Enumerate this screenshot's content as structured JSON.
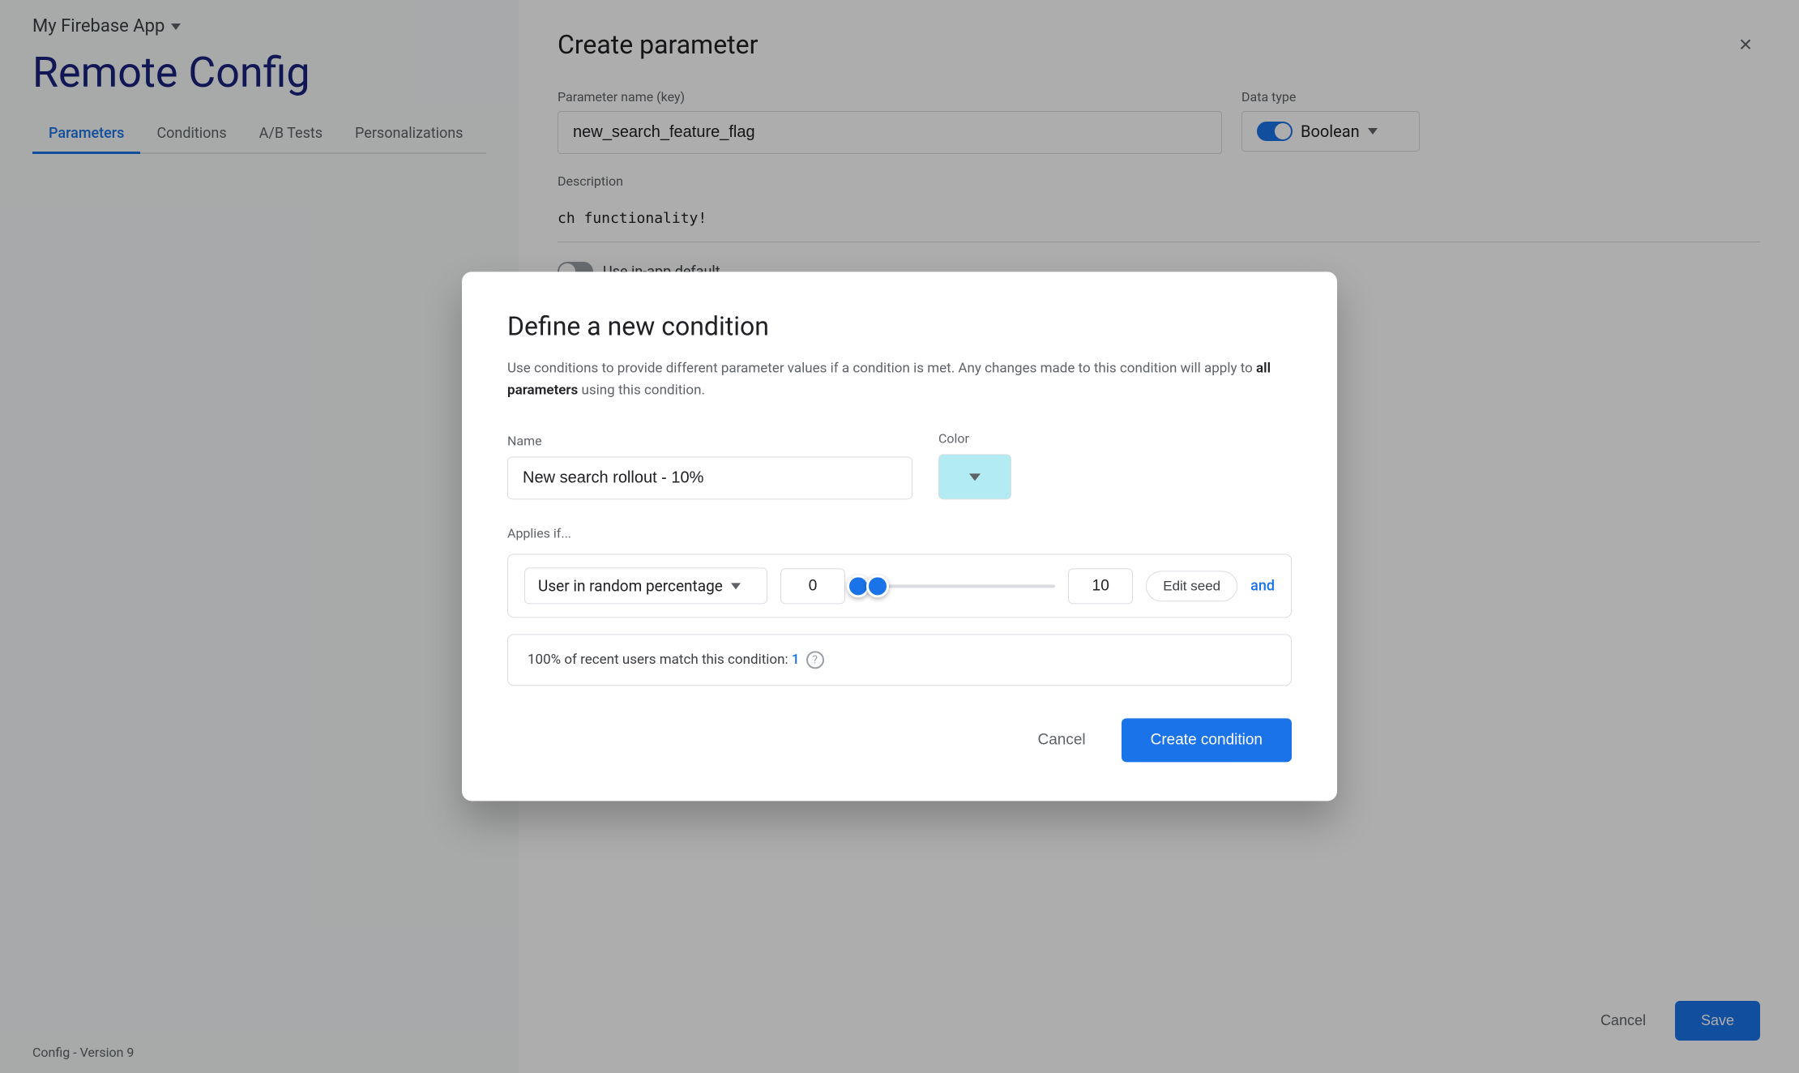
{
  "app": {
    "name": "My Firebase App",
    "dropdown_label": "dropdown"
  },
  "page": {
    "title": "Remote Config",
    "status_bar": "Config - Version 9"
  },
  "tabs": [
    {
      "id": "parameters",
      "label": "Parameters",
      "active": true
    },
    {
      "id": "conditions",
      "label": "Conditions",
      "active": false
    },
    {
      "id": "ab_tests",
      "label": "A/B Tests",
      "active": false
    },
    {
      "id": "personalizations",
      "label": "Personalizations",
      "active": false
    }
  ],
  "create_param_panel": {
    "title": "Create parameter",
    "close_label": "×",
    "fields": {
      "param_name_label": "Parameter name (key)",
      "param_name_value": "new_search_feature_flag",
      "data_type_label": "Data type",
      "data_type_value": "Boolean",
      "description_label": "Description",
      "description_value": "ch functionality!"
    },
    "use_default_label": "Use in-app default",
    "cancel_label": "Cancel",
    "save_label": "Save"
  },
  "modal": {
    "title": "Define a new condition",
    "description": "Use conditions to provide different parameter values if a condition is met. Any changes made to this condition will apply to",
    "description_bold": "all parameters",
    "description_suffix": " using this condition.",
    "name_label": "Name",
    "name_value": "New search rollout - 10%",
    "color_label": "Color",
    "applies_if_label": "Applies if...",
    "condition_type": "User in random percentage",
    "min_value": "0",
    "max_value": "10",
    "slider_fill_percent": 10,
    "edit_seed_label": "Edit seed",
    "and_label": "and",
    "match_text": "100% of recent users match this condition:",
    "match_link": "1",
    "cancel_label": "Cancel",
    "create_label": "Create condition"
  },
  "icons": {
    "help": "?",
    "close": "×",
    "dropdown_arrow": "▾"
  }
}
